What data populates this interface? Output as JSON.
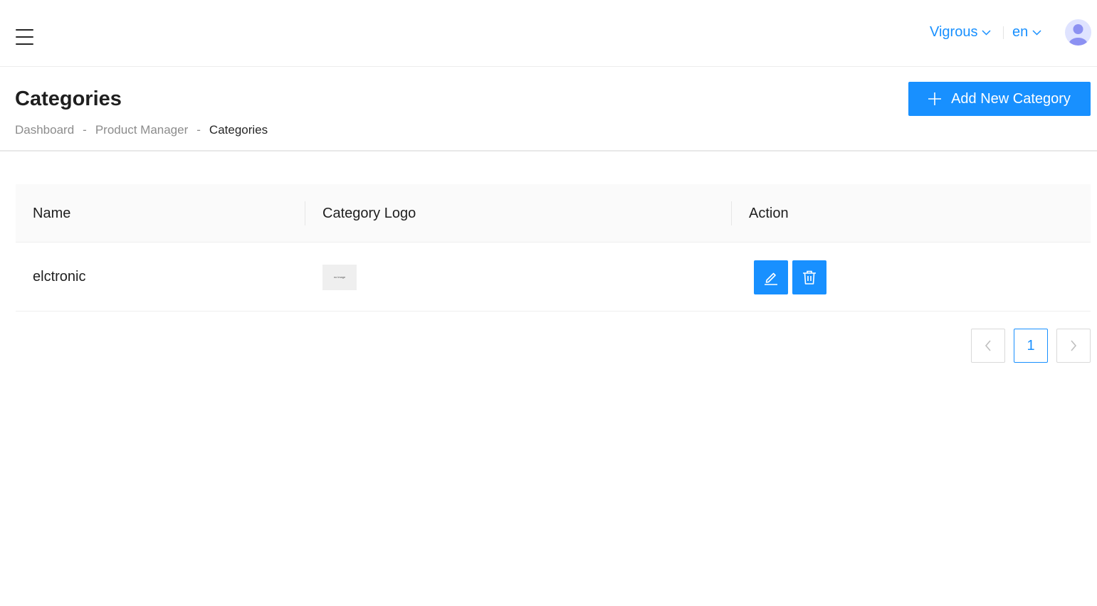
{
  "header": {
    "store_selector": "Vigrous",
    "language_selector": "en",
    "icons": {
      "menu": "hamburger-menu-icon",
      "dropdown": "chevron-down-icon",
      "avatar": "user-avatar-icon"
    },
    "accent_color": "#1890ff"
  },
  "page": {
    "title": "Categories",
    "breadcrumb": [
      "Dashboard",
      "Product Manager",
      "Categories"
    ],
    "breadcrumb_separator": "-",
    "add_button_label": "Add New Category"
  },
  "table": {
    "columns": [
      "Name",
      "Category Logo",
      "Action"
    ],
    "rows": [
      {
        "name": "elctronic",
        "logo_text": "no image",
        "actions": [
          "edit-icon",
          "trash-icon"
        ]
      }
    ]
  },
  "pagination": {
    "current_page": "1",
    "prev_icon": "chevron-left-icon",
    "next_icon": "chevron-right-icon"
  }
}
